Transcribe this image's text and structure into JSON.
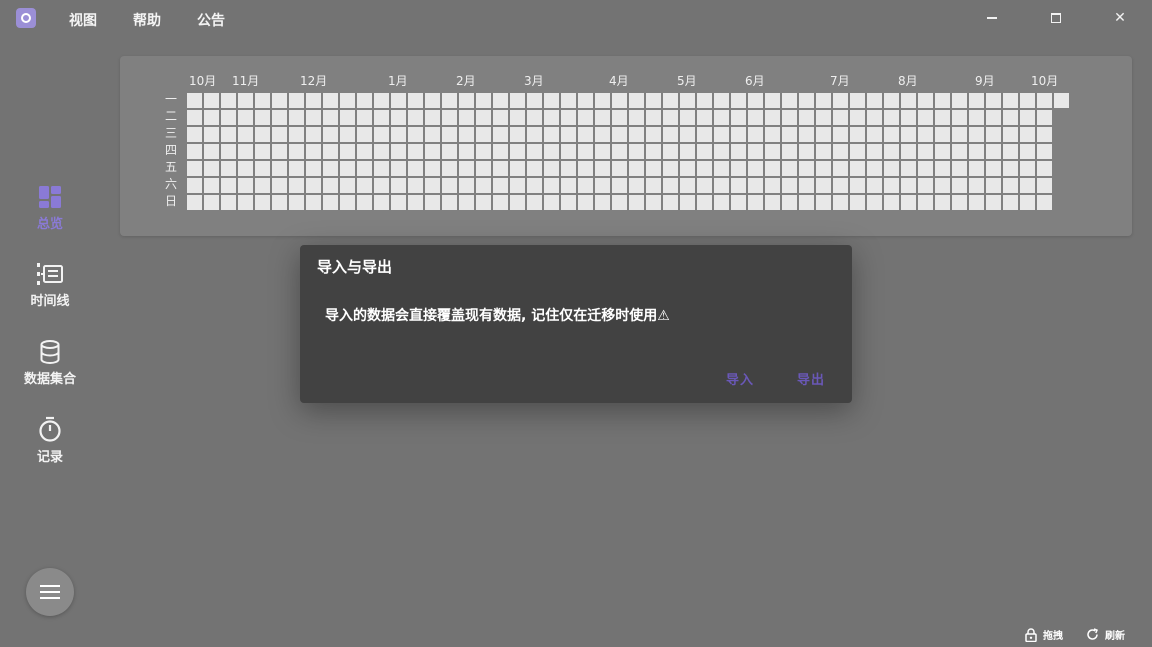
{
  "menu": {
    "view": "视图",
    "help": "帮助",
    "notice": "公告"
  },
  "window": {
    "close_glyph": "✕"
  },
  "sidebar": {
    "items": [
      {
        "label": "总览",
        "icon": "dashboard-icon",
        "active": true
      },
      {
        "label": "时间线",
        "icon": "timeline-icon",
        "active": false
      },
      {
        "label": "数据集合",
        "icon": "database-icon",
        "active": false
      },
      {
        "label": "记录",
        "icon": "stopwatch-icon",
        "active": false
      }
    ],
    "menu_icon": "hamburger-icon"
  },
  "heatmap": {
    "months": [
      "10月",
      "11月",
      "12月",
      "1月",
      "2月",
      "3月",
      "4月",
      "5月",
      "6月",
      "7月",
      "8月",
      "9月",
      "10月"
    ],
    "days": [
      "一",
      "二",
      "三",
      "四",
      "五",
      "六",
      "日"
    ],
    "cell_color": "#e8e8e8"
  },
  "dialog": {
    "title": "导入与导出",
    "message": "导入的数据会直接覆盖现有数据, 记住仅在迁移时使用⚠",
    "import_label": "导入",
    "export_label": "导出",
    "accent": "#6a58b8"
  },
  "status": {
    "drag_label": "拖拽",
    "refresh_label": "刷新"
  }
}
